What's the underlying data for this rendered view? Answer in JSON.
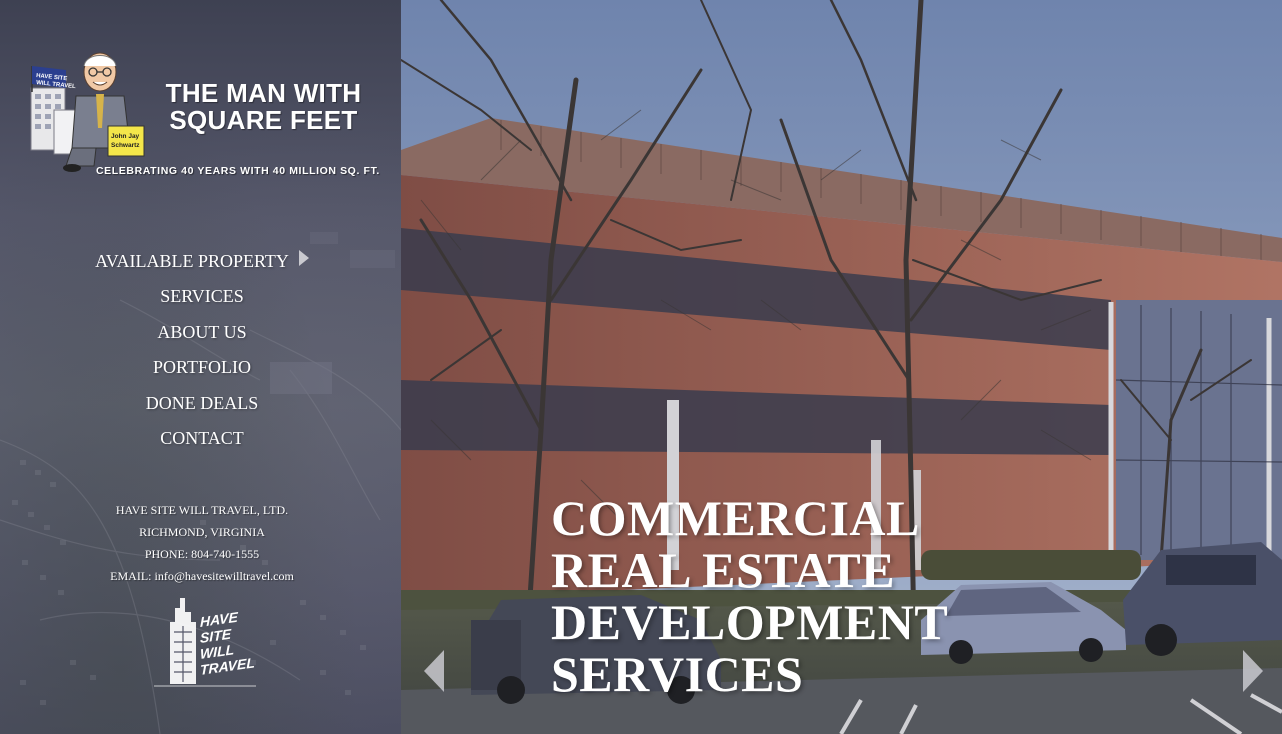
{
  "logo": {
    "title_line1": "THE MAN WITH",
    "title_line2": "SQUARE FEET",
    "tagline": "CELEBRATING 40 YEARS WITH 40 MILLION SQ. FT.",
    "flag_line1": "HAVE SITE",
    "flag_line2": "WILL TRAVEL",
    "sign_line1": "John Jay",
    "sign_line2": "Schwartz"
  },
  "nav": {
    "items": [
      {
        "label": "AVAILABLE PROPERTY",
        "has_submenu": true
      },
      {
        "label": "SERVICES"
      },
      {
        "label": "ABOUT US"
      },
      {
        "label": "PORTFOLIO"
      },
      {
        "label": "DONE DEALS"
      },
      {
        "label": "CONTACT"
      }
    ]
  },
  "contact": {
    "company": "HAVE SITE WILL TRAVEL, LTD.",
    "location": "RICHMOND, VIRGINIA",
    "phone": "PHONE: 804-740-1555",
    "email": "EMAIL: info@havesitewilltravel.com"
  },
  "brand_logo": {
    "line1": "HAVE",
    "line2": "SITE",
    "line3": "WILL",
    "line4": "TRAVEL"
  },
  "hero": {
    "headline": [
      "COMMERCIAL",
      "REAL ESTATE",
      "DEVELOPMENT",
      "SERVICES"
    ],
    "prev_icon": "chevron-left-icon",
    "next_icon": "chevron-right-icon"
  },
  "colors": {
    "sidebar_bg": "#55576a",
    "text": "#ffffff",
    "sky": "#8fa3c4",
    "brick": "#9a5f52"
  }
}
